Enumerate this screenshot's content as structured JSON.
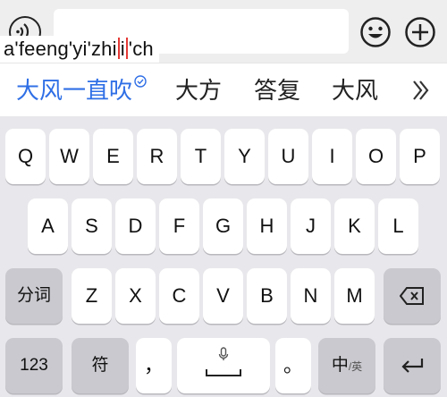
{
  "composing": {
    "segments": [
      "a'feeng'yi'zhi",
      "i",
      "'ch"
    ]
  },
  "candidates": [
    "大风一直吹",
    "大方",
    "答复",
    "大风"
  ],
  "keyboard": {
    "row1": [
      "Q",
      "W",
      "E",
      "R",
      "T",
      "Y",
      "U",
      "I",
      "O",
      "P"
    ],
    "row2": [
      "A",
      "S",
      "D",
      "F",
      "G",
      "H",
      "J",
      "K",
      "L"
    ],
    "row3": [
      "Z",
      "X",
      "C",
      "V",
      "B",
      "N",
      "M"
    ],
    "row3_left_label": "分词",
    "numbers_label": "123",
    "symbols_label": "符",
    "comma_label": "，",
    "period_label": "。",
    "lang_main_label": "中",
    "lang_sub_label": "/英"
  },
  "colors": {
    "accent": "#2f6fe6",
    "caret": "#e53935",
    "key_bg": "#ffffff",
    "func_key_bg": "#c9c9cf",
    "keyboard_bg": "#e8e8ec"
  },
  "icons": {
    "voice": "voice-wave-icon",
    "emoji": "smiley-icon",
    "plus": "plus-circle-icon",
    "more": "double-chevron-right-icon",
    "backspace": "backspace-icon",
    "enter": "enter-icon",
    "mic": "microphone-icon",
    "check": "check-circle-icon"
  }
}
